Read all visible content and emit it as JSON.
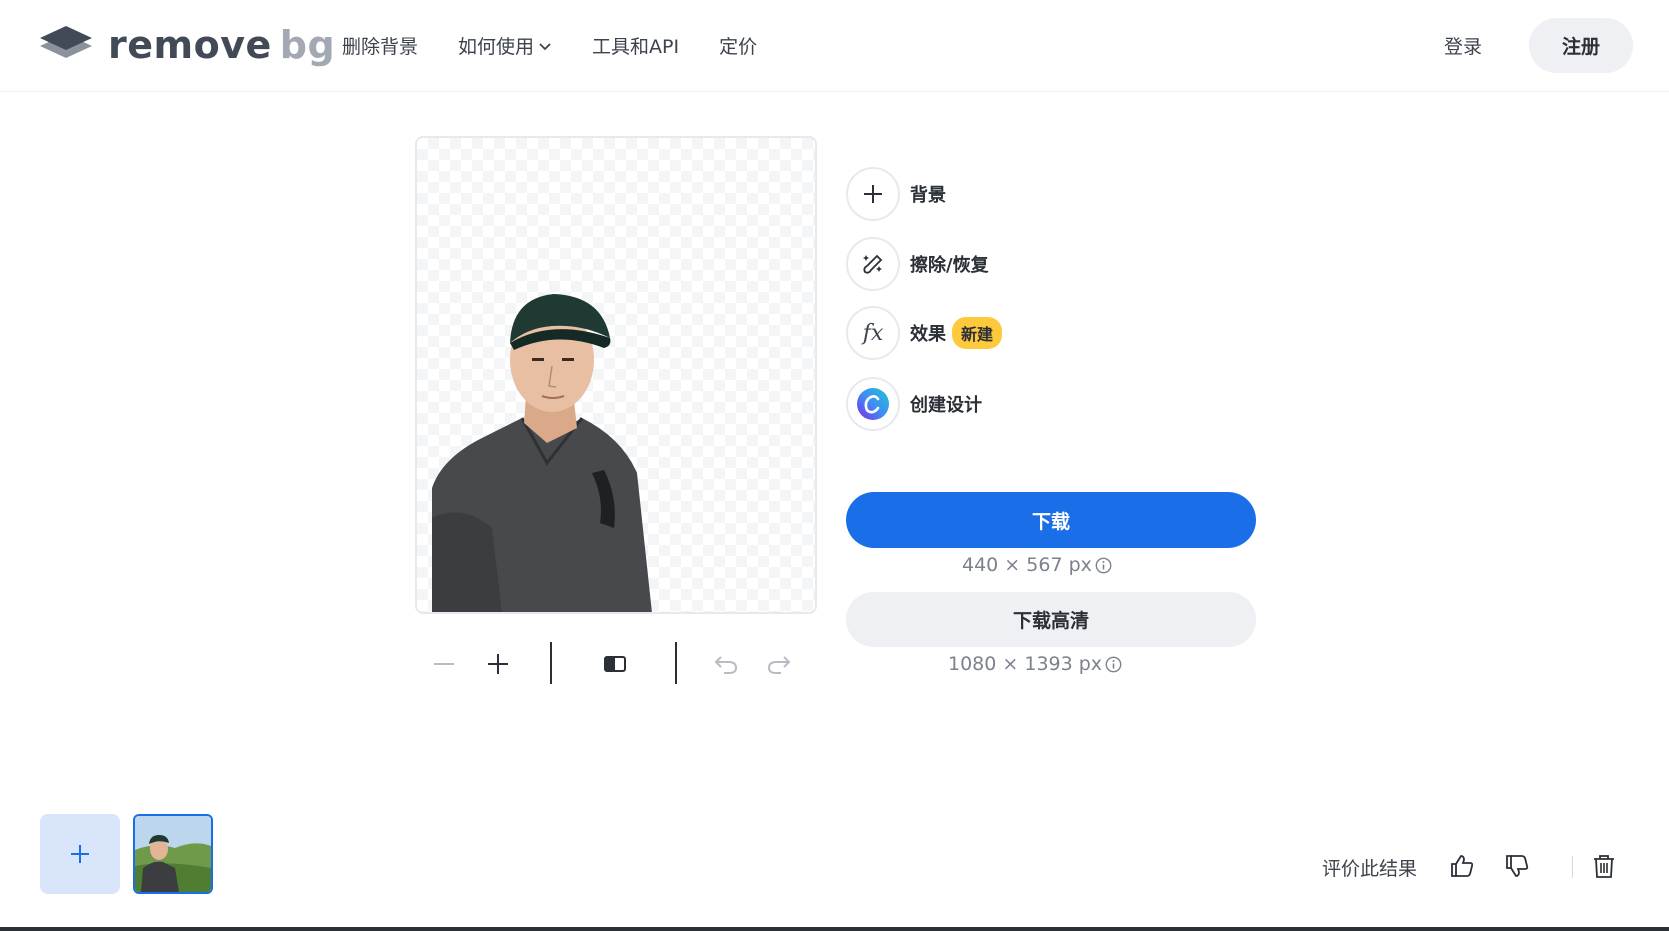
{
  "header": {
    "logo": {
      "part1": "remove",
      "part2": "bg"
    },
    "nav": [
      {
        "label": "删除背景"
      },
      {
        "label": "如何使用"
      },
      {
        "label": "工具和API"
      },
      {
        "label": "定价"
      }
    ],
    "login_label": "登录",
    "signup_label": "注册"
  },
  "actions": {
    "background_label": "背景",
    "erase_restore_label": "擦除/恢复",
    "effects_label": "效果",
    "effects_badge": "新建",
    "create_design_label": "创建设计",
    "fx_glyph": "fx"
  },
  "download": {
    "label": "下载",
    "size": "440 × 567 px",
    "hd_label": "下载高清",
    "hd_size": "1080 × 1393 px"
  },
  "bottom": {
    "rate_label": "评价此结果"
  },
  "colors": {
    "accent": "#1a6fe8",
    "badge": "#ffc93c",
    "surface": "#eef0f3"
  }
}
